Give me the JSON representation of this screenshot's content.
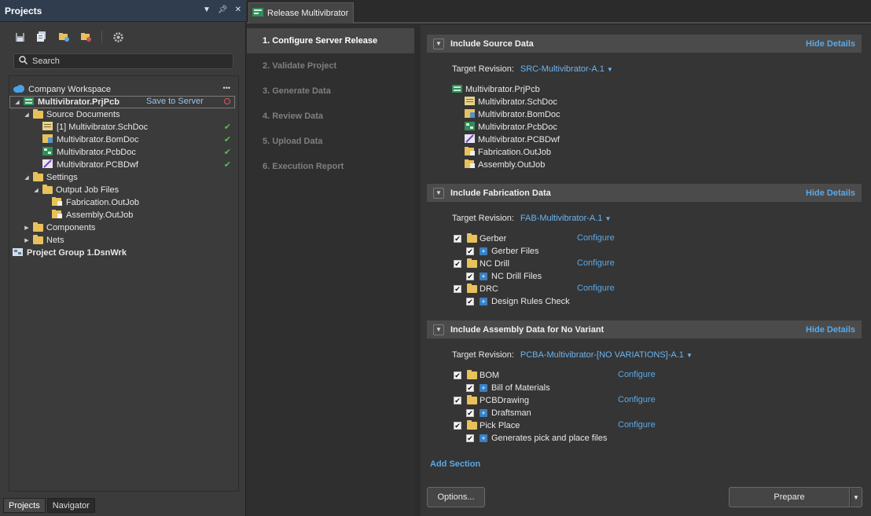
{
  "projects_panel": {
    "title": "Projects",
    "search_placeholder": "Search",
    "workspace": "Company Workspace",
    "workspace_more": "•••",
    "project": {
      "name": "Multivibrator.PrjPcb",
      "action": "Save to Server"
    },
    "source_documents": "Source Documents",
    "documents": [
      "[1] Multivibrator.SchDoc",
      "Multivibrator.BomDoc",
      "Multivibrator.PcbDoc",
      "Multivibrator.PCBDwf"
    ],
    "settings": "Settings",
    "output_job_files": "Output Job Files",
    "outjobs": [
      "Fabrication.OutJob",
      "Assembly.OutJob"
    ],
    "components": "Components",
    "nets": "Nets",
    "project_group": "Project Group 1.DsnWrk",
    "tabs": [
      "Projects",
      "Navigator"
    ]
  },
  "doc_tab": {
    "label": "Release Multivibrator"
  },
  "steps": [
    "1. Configure Server Release",
    "2. Validate Project",
    "3. Generate Data",
    "4. Review Data",
    "5. Upload Data",
    "6. Execution Report"
  ],
  "source_section": {
    "title": "Include Source Data",
    "hide_details": "Hide Details",
    "target_label": "Target Revision:",
    "target_value": "SRC-Multivibrator-A.1",
    "project_file": "Multivibrator.PrjPcb",
    "files": [
      "Multivibrator.SchDoc",
      "Multivibrator.BomDoc",
      "Multivibrator.PcbDoc",
      "Multivibrator.PCBDwf",
      "Fabrication.OutJob",
      "Assembly.OutJob"
    ]
  },
  "fab_section": {
    "title": "Include Fabrication Data",
    "hide_details": "Hide Details",
    "target_label": "Target Revision:",
    "target_value": "FAB-Multivibrator-A.1",
    "items": [
      {
        "name": "Gerber",
        "child": "Gerber Files",
        "configure": "Configure"
      },
      {
        "name": "NC Drill",
        "child": "NC Drill Files",
        "configure": "Configure"
      },
      {
        "name": "DRC",
        "child": "Design Rules Check",
        "configure": "Configure"
      }
    ]
  },
  "asm_section": {
    "title": "Include Assembly Data for No Variant",
    "hide_details": "Hide Details",
    "target_label": "Target Revision:",
    "target_value": "PCBA-Multivibrator-[NO VARIATIONS]-A.1",
    "items": [
      {
        "name": "BOM",
        "child": "Bill of Materials",
        "configure": "Configure"
      },
      {
        "name": "PCBDrawing",
        "child": "Draftsman",
        "configure": "Configure"
      },
      {
        "name": "Pick Place",
        "child": "Generates pick and place files",
        "configure": "Configure"
      }
    ]
  },
  "add_section": "Add Section",
  "buttons": {
    "options": "Options...",
    "prepare": "Prepare"
  }
}
